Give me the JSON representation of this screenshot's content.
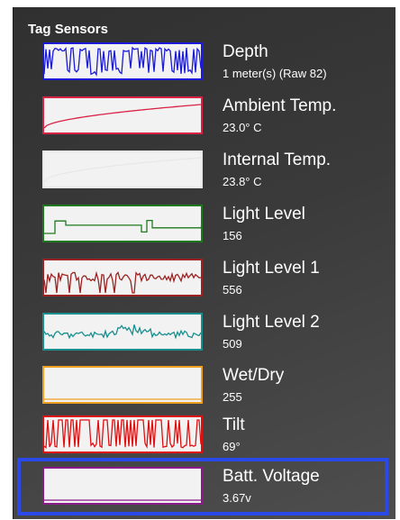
{
  "panel": {
    "title": "Tag Sensors"
  },
  "sensors": [
    {
      "label": "Depth",
      "value": "1 meter(s) (Raw 82)",
      "color": "#1a1ad8"
    },
    {
      "label": "Ambient Temp.",
      "value": "23.0° C",
      "color": "#d92246"
    },
    {
      "label": "Internal Temp.",
      "value": "23.8° C",
      "color": "#e8e8e8"
    },
    {
      "label": "Light Level",
      "value": "156",
      "color": "#1f7a1f"
    },
    {
      "label": "Light Level 1",
      "value": "556",
      "color": "#9b2323"
    },
    {
      "label": "Light Level 2",
      "value": "509",
      "color": "#1a8f8f"
    },
    {
      "label": "Wet/Dry",
      "value": "255",
      "color": "#f0a020"
    },
    {
      "label": "Tilt",
      "value": "69°",
      "color": "#e01010"
    },
    {
      "label": "Batt. Voltage",
      "value": "3.67v",
      "color": "#8a1a8a"
    }
  ],
  "selection": {
    "index": 8,
    "color": "#2a49e8"
  }
}
